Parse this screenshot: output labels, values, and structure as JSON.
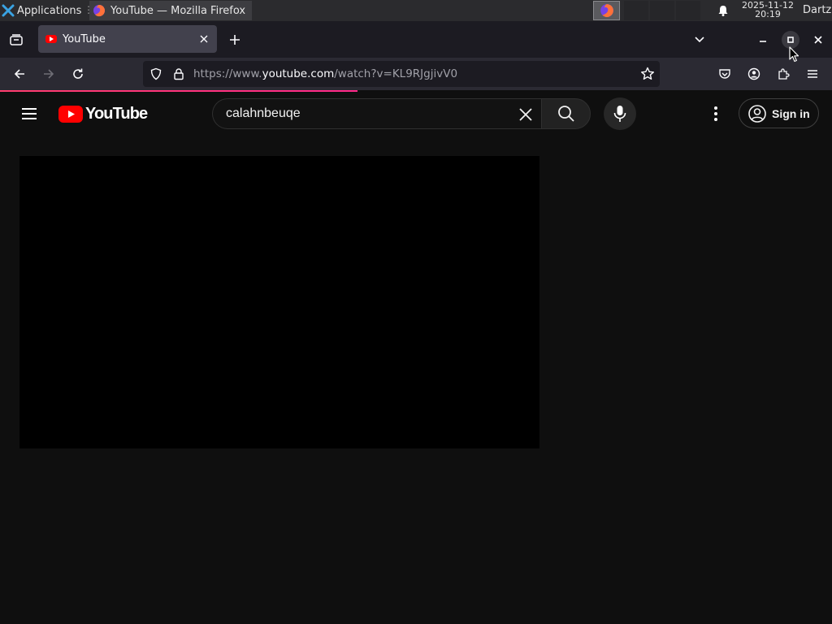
{
  "taskbar": {
    "applications_label": "Applications",
    "window_title": "YouTube — Mozilla Firefox",
    "clock_date": "2025-11-12",
    "clock_time": "20:19",
    "user": "Dartz"
  },
  "browser": {
    "tab_title": "YouTube",
    "url_prefix": "https://www.",
    "url_host": "youtube.com",
    "url_path": "/watch?v=KL9RJgjivV0",
    "page_load_progress_percent": 43
  },
  "youtube": {
    "logo_text": "YouTube",
    "search_value": "calahnbeuqe",
    "signin_label": "Sign in"
  },
  "colors": {
    "youtube_red": "#ff0000",
    "firefox_progress": "#ff3d6e",
    "page_background": "#0f0f0f"
  },
  "icons": [
    "tab-list-icon",
    "close-icon",
    "plus-icon",
    "chevron-down-icon",
    "minimize-icon",
    "maximize-icon",
    "back-arrow-icon",
    "forward-arrow-icon",
    "reload-icon",
    "shield-icon",
    "lock-icon",
    "star-icon",
    "pocket-icon",
    "account-icon",
    "extensions-icon",
    "hamburger-menu-icon",
    "search-icon",
    "microphone-icon",
    "more-vertical-icon",
    "bell-icon"
  ]
}
